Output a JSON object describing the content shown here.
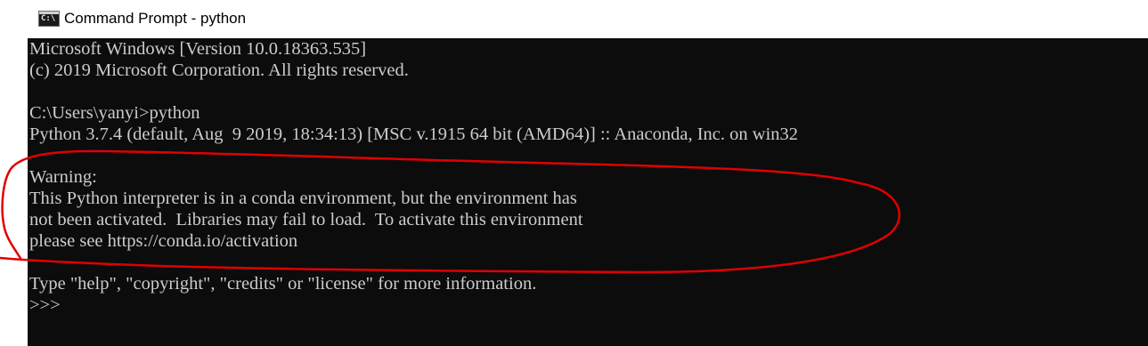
{
  "window": {
    "title": "Command Prompt - python",
    "icon": "cmd-console-icon",
    "icon_text": "C:\\"
  },
  "console": {
    "lines": [
      "Microsoft Windows [Version 10.0.18363.535]",
      "(c) 2019 Microsoft Corporation. All rights reserved.",
      "",
      "C:\\Users\\yanyi>python",
      "Python 3.7.4 (default, Aug  9 2019, 18:34:13) [MSC v.1915 64 bit (AMD64)] :: Anaconda, Inc. on win32",
      "",
      "Warning:",
      "This Python interpreter is in a conda environment, but the environment has",
      "not been activated.  Libraries may fail to load.  To activate this environment",
      "please see https://conda.io/activation",
      "",
      "Type \"help\", \"copyright\", \"credits\" or \"license\" for more information.",
      ">>>"
    ]
  },
  "colors": {
    "console_background": "#0c0c0c",
    "console_text": "#cccccc",
    "annotation_stroke": "#e00000"
  }
}
